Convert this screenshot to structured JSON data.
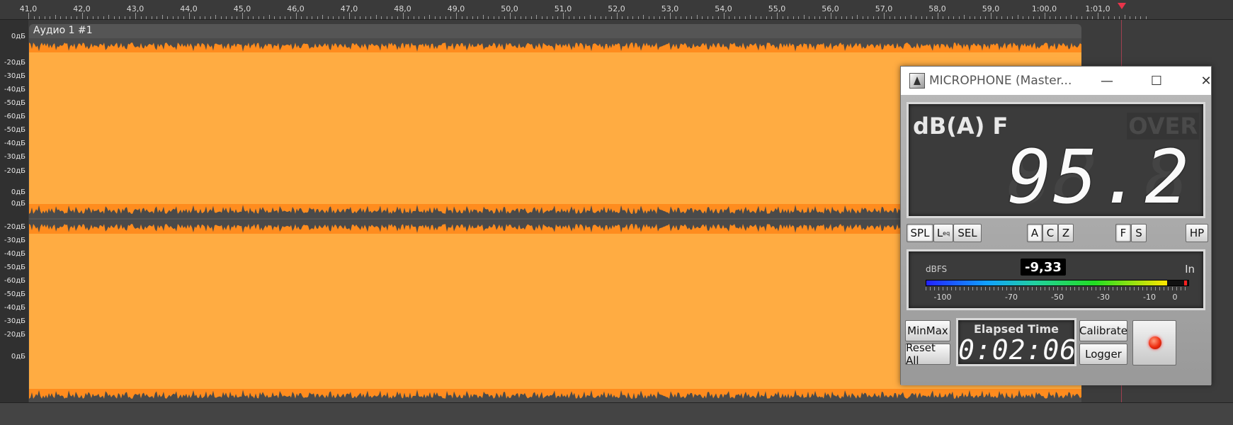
{
  "ruler": {
    "ticks": [
      "41,0",
      "42,0",
      "43,0",
      "44,0",
      "45,0",
      "46,0",
      "47,0",
      "48,0",
      "49,0",
      "50,0",
      "51,0",
      "52,0",
      "53,0",
      "54,0",
      "55,0",
      "56,0",
      "57,0",
      "58,0",
      "59,0",
      "1:00,0",
      "1:01,0"
    ]
  },
  "db_scale": {
    "channel1": [
      "0дБ",
      "-20дБ",
      "-30дБ",
      "-40дБ",
      "-50дБ",
      "-60дБ",
      "-50дБ",
      "-40дБ",
      "-30дБ",
      "-20дБ",
      "0дБ"
    ],
    "channel2": [
      "0дБ",
      "-20дБ",
      "-30дБ",
      "-40дБ",
      "-50дБ",
      "-60дБ",
      "-50дБ",
      "-40дБ",
      "-30дБ",
      "-20дБ",
      "0дБ"
    ]
  },
  "clip": {
    "title": "Аудио 1 #1"
  },
  "colors": {
    "waveform": "#ffac42",
    "waveform_edge": "#ff8c1e",
    "playhead": "#e8344a"
  },
  "meter": {
    "title": "MICROPHONE (Master...",
    "window_icons": {
      "minimize": "minimize-icon",
      "maximize": "maximize-icon",
      "close": "close-icon"
    },
    "weighting_label": "dB(A) F",
    "over_label": "OVER",
    "reading": "95.2",
    "reading_ghost": "88.8",
    "buttons": {
      "spl": "SPL",
      "leq": "L",
      "leq_sub": "eq",
      "sel": "SEL",
      "a": "A",
      "c": "C",
      "z": "Z",
      "f": "F",
      "s": "S",
      "hp": "HP",
      "minmax": "MinMax",
      "reset_all": "Reset All",
      "calibrate": "Calibrate",
      "logger": "Logger"
    },
    "level": {
      "unit_label": "dBFS",
      "value": "-9,33",
      "input_label": "In",
      "scale": [
        "-100",
        "-70",
        "-50",
        "-30",
        "-10",
        "0"
      ],
      "fill_fraction": 0.92
    },
    "elapsed": {
      "label": "Elapsed Time",
      "value": "0:02:06"
    }
  }
}
